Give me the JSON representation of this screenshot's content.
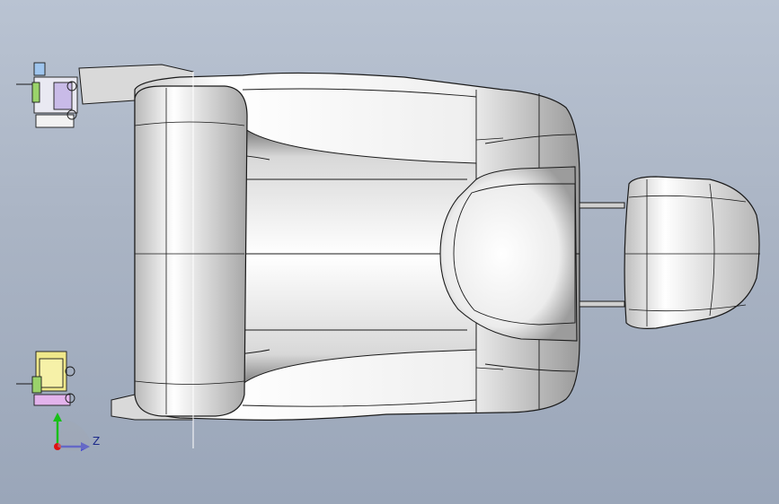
{
  "viewport": {
    "background_top": "#b9c3d2",
    "background_bottom": "#9aa6b9",
    "model_fill": "#e6e6e6",
    "edge_color": "#1a1a1a"
  },
  "triad": {
    "z_label": "Z",
    "x_axis_color": "#2a2ad8",
    "y_axis_color": "#18c018",
    "origin_color": "#e01010"
  },
  "components": [
    "seat-cushion",
    "seat-back",
    "headrest",
    "recliner-mechanism-top",
    "recliner-mechanism-bottom",
    "seat-frame-rail"
  ]
}
